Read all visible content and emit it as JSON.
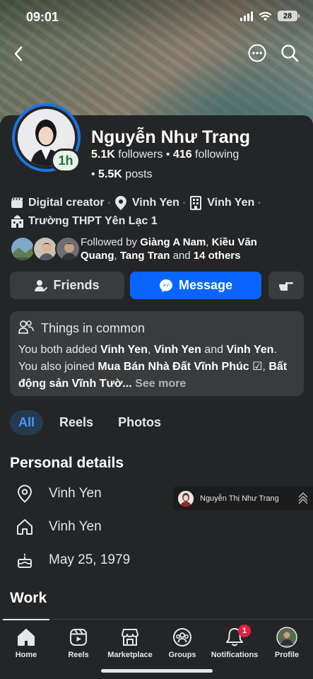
{
  "status_bar": {
    "time": "09:01",
    "battery": "28"
  },
  "profile": {
    "name": "Nguyễn Như Trang",
    "followers_count": "5.1K",
    "followers_label": "followers",
    "following_count": "416",
    "following_label": "following",
    "posts_count": "5.5K",
    "posts_label": "posts",
    "active_badge": "1h"
  },
  "intro": {
    "role": "Digital creator",
    "location": "Vinh Yen",
    "hometown": "Vinh Yen",
    "school": "Trường THPT Yên Lạc 1"
  },
  "followed_by": {
    "prefix": "Followed by",
    "names": [
      "Giàng A Nam",
      "Kiều Văn Quang",
      "Tang Tran"
    ],
    "others": "14 others"
  },
  "actions": {
    "friends_label": "Friends",
    "message_label": "Message"
  },
  "things_in_common": {
    "title": "Things in common",
    "text_1": "You both added ",
    "place_1": "Vinh Yen",
    "place_2": "Vinh Yen",
    "and": " and ",
    "place_3": "Vinh Yen",
    "text_2": ". You also joined ",
    "group_1": "Mua Bán Nhà Đất Vĩnh Phúc ☑",
    "group_2": "Bất động sản Vĩnh Tườ...",
    "see_more": "See more"
  },
  "tabs": [
    {
      "label": "All"
    },
    {
      "label": "Reels"
    },
    {
      "label": "Photos"
    }
  ],
  "personal_details": {
    "title": "Personal details",
    "current_city": "Vinh Yen",
    "hometown": "Vinh Yen",
    "birthday": "May 25, 1979"
  },
  "work": {
    "title": "Work"
  },
  "mini_chat": {
    "name": "Nguyễn Thị Như Trang"
  },
  "bottom_nav": [
    {
      "label": "Home"
    },
    {
      "label": "Reels"
    },
    {
      "label": "Marketplace"
    },
    {
      "label": "Groups"
    },
    {
      "label": "Notifications",
      "badge": "1"
    },
    {
      "label": "Profile"
    }
  ],
  "colors": {
    "accent": "#0866ff",
    "background": "#242526",
    "card": "#3a3b3c",
    "badge": "#e41e3f"
  }
}
